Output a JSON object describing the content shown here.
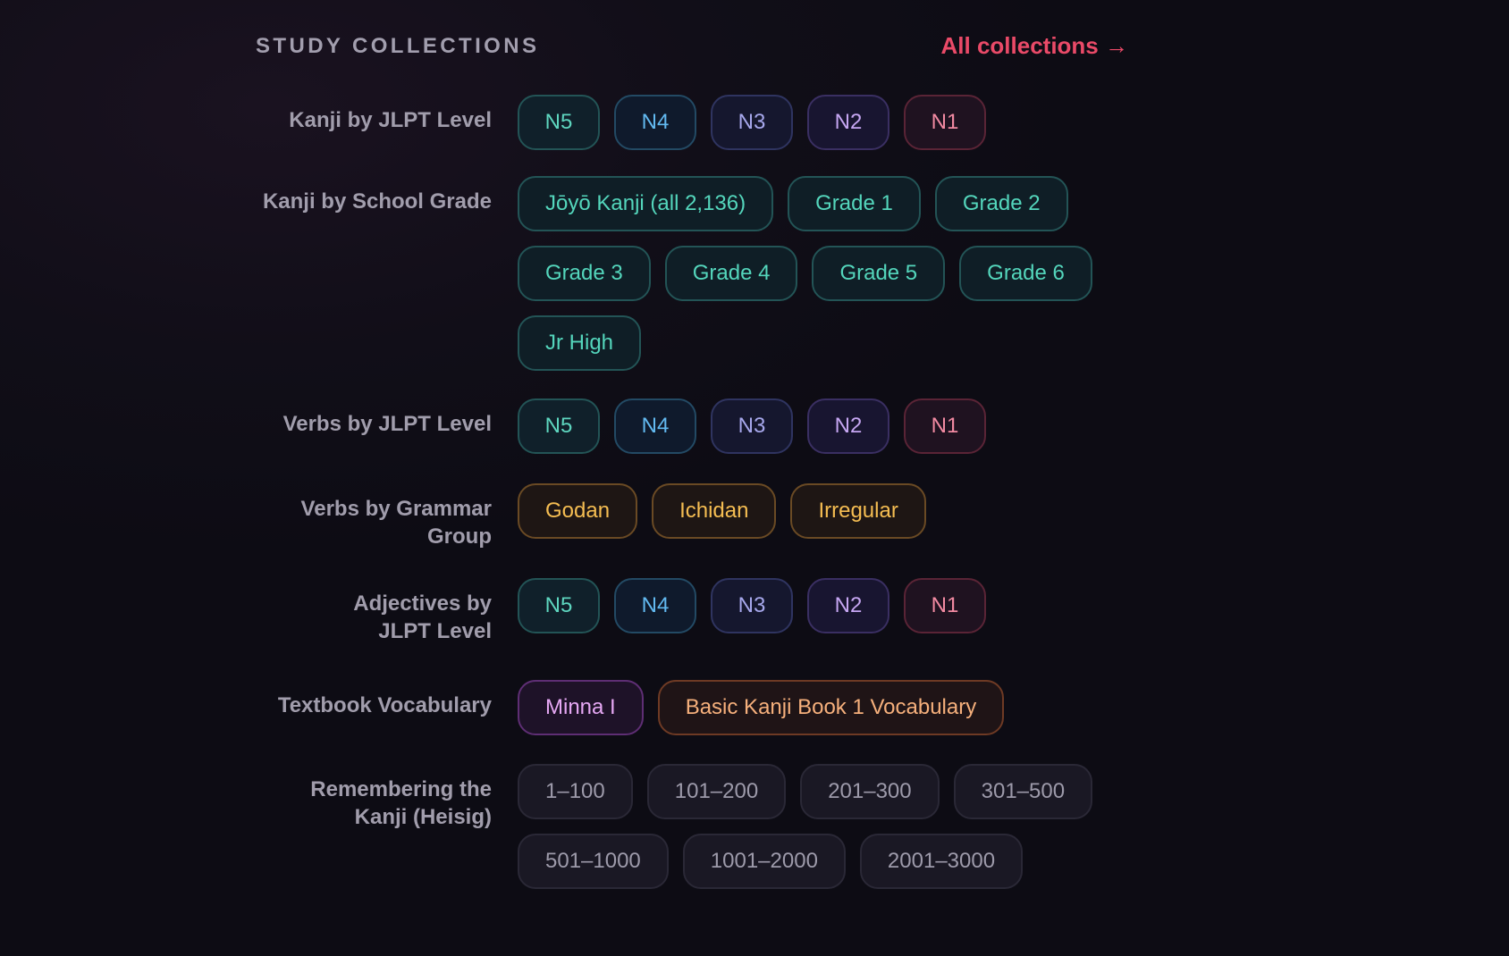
{
  "header": {
    "title": "STUDY COLLECTIONS",
    "all_link": "All collections →"
  },
  "groups": [
    {
      "label": "Kanji by JLPT Level",
      "chips": [
        {
          "text": "N5",
          "variant": "n5"
        },
        {
          "text": "N4",
          "variant": "n4"
        },
        {
          "text": "N3",
          "variant": "n3"
        },
        {
          "text": "N2",
          "variant": "n2"
        },
        {
          "text": "N1",
          "variant": "n1"
        }
      ]
    },
    {
      "label": "Kanji by School Grade",
      "chips": [
        {
          "text": "Jōyō Kanji (all 2,136)",
          "variant": "teal"
        },
        {
          "text": "Grade 1",
          "variant": "teal"
        },
        {
          "text": "Grade 2",
          "variant": "teal"
        },
        {
          "text": "Grade 3",
          "variant": "teal"
        },
        {
          "text": "Grade 4",
          "variant": "teal"
        },
        {
          "text": "Grade 5",
          "variant": "teal"
        },
        {
          "text": "Grade 6",
          "variant": "teal"
        },
        {
          "text": "Jr High",
          "variant": "teal"
        }
      ]
    },
    {
      "label": "Verbs by JLPT Level",
      "chips": [
        {
          "text": "N5",
          "variant": "n5"
        },
        {
          "text": "N4",
          "variant": "n4"
        },
        {
          "text": "N3",
          "variant": "n3"
        },
        {
          "text": "N2",
          "variant": "n2"
        },
        {
          "text": "N1",
          "variant": "n1"
        }
      ]
    },
    {
      "label": "Verbs by Grammar Group",
      "chips": [
        {
          "text": "Godan",
          "variant": "gold"
        },
        {
          "text": "Ichidan",
          "variant": "gold"
        },
        {
          "text": "Irregular",
          "variant": "gold"
        }
      ]
    },
    {
      "label": "Adjectives by JLPT Level",
      "chips": [
        {
          "text": "N5",
          "variant": "n5"
        },
        {
          "text": "N4",
          "variant": "n4"
        },
        {
          "text": "N3",
          "variant": "n3"
        },
        {
          "text": "N2",
          "variant": "n2"
        },
        {
          "text": "N1",
          "variant": "n1"
        }
      ]
    },
    {
      "label": "Textbook Vocabulary",
      "chips": [
        {
          "text": "Minna I",
          "variant": "purp"
        },
        {
          "text": "Basic Kanji Book 1 Vocabulary",
          "variant": "orng"
        }
      ]
    },
    {
      "label": "Remembering the Kanji (Heisig)",
      "chips": [
        {
          "text": "1–100",
          "variant": "gray"
        },
        {
          "text": "101–200",
          "variant": "gray"
        },
        {
          "text": "201–300",
          "variant": "gray"
        },
        {
          "text": "301–500",
          "variant": "gray"
        },
        {
          "text": "501–1000",
          "variant": "gray"
        },
        {
          "text": "1001–2000",
          "variant": "gray"
        },
        {
          "text": "2001–3000",
          "variant": "gray"
        }
      ]
    }
  ],
  "colors": {
    "accent": "#ea4a68",
    "background": "#0f0d16"
  }
}
